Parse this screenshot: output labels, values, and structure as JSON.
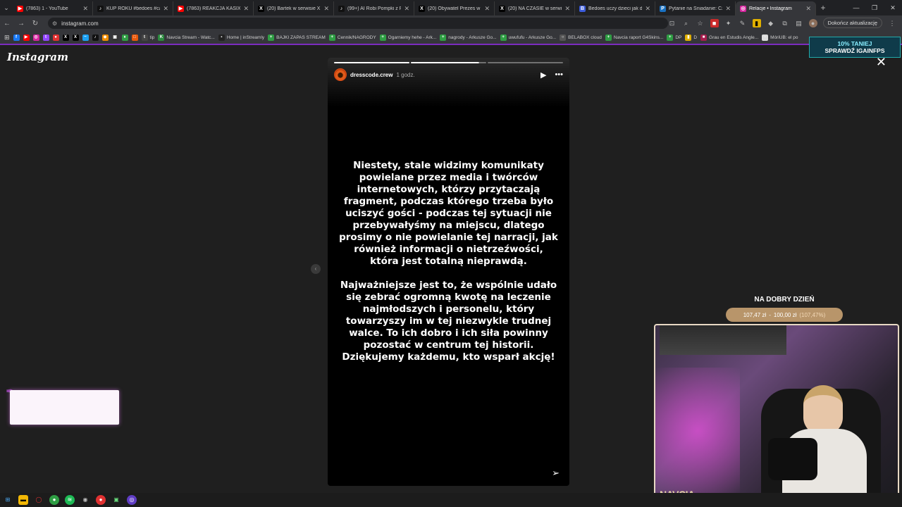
{
  "browser": {
    "tabs": [
      {
        "label": "(7863) 1 - YouTube",
        "icon": "youtube-icon",
        "color": "#ff0000",
        "glyph": "▶"
      },
      {
        "label": "KUP ROKU #bedoes #cancel",
        "icon": "tiktok-icon",
        "color": "#111111",
        "glyph": "♪"
      },
      {
        "label": "(7863) REAKCJA KASIX NA BE",
        "icon": "youtube-icon",
        "color": "#ff0000",
        "glyph": "▶"
      },
      {
        "label": "(20) Bartek w serwisie X: „",
        "icon": "x-icon",
        "color": "#000000",
        "glyph": "X"
      },
      {
        "label": "(99+) AI Robi Pompki z Piekar",
        "icon": "tiktok-icon",
        "color": "#111111",
        "glyph": "♪"
      },
      {
        "label": "(20) Obywatel Prezes w serwi",
        "icon": "x-icon",
        "color": "#000000",
        "glyph": "X"
      },
      {
        "label": "(20) NA CZASIE w serwisie X:",
        "icon": "x-icon",
        "color": "#000000",
        "glyph": "X"
      },
      {
        "label": "Bedoes uczy dzieci jak działa",
        "icon": "web-icon",
        "color": "#3b5bdb",
        "glyph": "B"
      },
      {
        "label": "Pytanie na Śniadanie: Czerwo",
        "icon": "web-icon",
        "color": "#1971c2",
        "glyph": "P"
      },
      {
        "label": "Relacje • Instagram",
        "icon": "instagram-icon",
        "color": "#d6249f",
        "glyph": "◎",
        "active": true
      }
    ],
    "new_tab": "+",
    "url": "instagram.com",
    "update_button": "Dokończ aktualizację",
    "bookmarks": [
      {
        "label": "",
        "color": "#1877f2",
        "glyph": "f"
      },
      {
        "label": "",
        "color": "#ff0000",
        "glyph": "▶"
      },
      {
        "label": "",
        "color": "#d6249f",
        "glyph": "◎"
      },
      {
        "label": "",
        "color": "#9146ff",
        "glyph": "t"
      },
      {
        "label": "",
        "color": "#e03131",
        "glyph": "●"
      },
      {
        "label": "",
        "color": "#000000",
        "glyph": "X"
      },
      {
        "label": "",
        "color": "#000000",
        "glyph": "X"
      },
      {
        "label": "",
        "color": "#1da1f2",
        "glyph": "~"
      },
      {
        "label": "",
        "color": "#111111",
        "glyph": "♪"
      },
      {
        "label": "",
        "color": "#f08c00",
        "glyph": "◆"
      },
      {
        "label": "",
        "color": "#333333",
        "glyph": "▣"
      },
      {
        "label": "",
        "color": "#2f9e44",
        "glyph": "♦"
      },
      {
        "label": "",
        "color": "#e8590c",
        "glyph": "□"
      },
      {
        "label": "tip",
        "color": "#444444",
        "glyph": "t"
      },
      {
        "label": "Navcia Stream - Watc...",
        "color": "#2b8a3e",
        "glyph": "K"
      },
      {
        "label": "Home | inStreamly",
        "color": "#222222",
        "glyph": "▪"
      },
      {
        "label": "BAJKI ZAPAS STREAM",
        "color": "#2f9e44",
        "glyph": "+"
      },
      {
        "label": "Cennik/NAGRODY",
        "color": "#2f9e44",
        "glyph": "+"
      },
      {
        "label": "Ogarniemy hehe - Ark...",
        "color": "#2f9e44",
        "glyph": "+"
      },
      {
        "label": "nagrody - Arkusze Go...",
        "color": "#2f9e44",
        "glyph": "+"
      },
      {
        "label": "uwufufu - Arkusze Go...",
        "color": "#2f9e44",
        "glyph": "+"
      },
      {
        "label": "BELABOX cloud",
        "color": "#555555",
        "glyph": "○"
      },
      {
        "label": "Navcia raport G4Skins...",
        "color": "#2f9e44",
        "glyph": "+"
      },
      {
        "label": "DP",
        "color": "#2f9e44",
        "glyph": "+"
      },
      {
        "label": "D",
        "color": "#e0b000",
        "glyph": "▮"
      },
      {
        "label": "Grau en Estudis Angle...",
        "color": "#a61e4d",
        "glyph": "■"
      },
      {
        "label": "MóriUB: el po",
        "color": "#dddddd",
        "glyph": "▫"
      }
    ]
  },
  "instagram": {
    "logo": "Instagram",
    "story": {
      "username": "dresscode.crew",
      "time": "1 godz.",
      "progress_segments": 3,
      "completed_segments": 1,
      "active_segment_progress": 0.9,
      "paragraph1": "Niestety, stale widzimy komunikaty powielane przez media i twórców internetowych, którzy przytaczają fragment, podczas którego trzeba było uciszyć gości - podczas tej sytuacji nie przebywałyśmy na miejscu, dlatego prosimy o nie powielanie tej narracji, jak również informacji o nietrzeźwości, która jest totalną nieprawdą.",
      "paragraph2": "Najważniejsze jest to, że wspólnie udało się zebrać ogromną kwotę na leczenie najmłodszych i personelu, który towarzyszy im w tej niezwykle trudnej walce. To ich dobro i ich siła powinny pozostać w centrum tej historii. Dziękujemy każdemu, kto wsparł akcję!"
    }
  },
  "overlay": {
    "promo_line1": "10% TANIEJ",
    "promo_line2": "SPRAWDŹ IGAINFPS",
    "goal_title": "NA DOBRY DZIEŃ",
    "goal_current": "107,47 zł",
    "goal_separator": "-",
    "goal_target": "100,00 zł",
    "goal_percent": "(107,47%)",
    "cam_label": "NAVCIA"
  }
}
